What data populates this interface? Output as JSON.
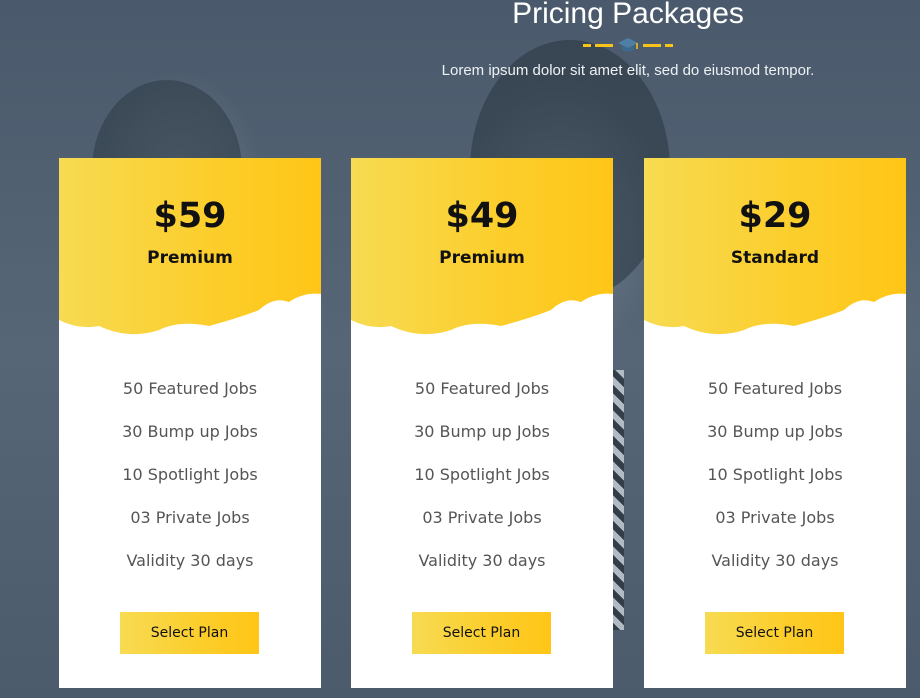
{
  "header": {
    "title": "Pricing Packages",
    "subtitle": "Lorem ipsum dolor sit amet elit, sed do eiusmod tempor.",
    "divider_icon": "graduation-cap-icon"
  },
  "colors": {
    "accent": "#fccd2a",
    "accent_light": "#f7db52",
    "accent_dark": "#ffc617"
  },
  "plans": [
    {
      "price": "$59",
      "name": "Premium",
      "features": [
        "50 Featured Jobs",
        "30 Bump up Jobs",
        "10 Spotlight Jobs",
        "03 Private Jobs",
        "Validity 30 days"
      ],
      "button_label": "Select Plan"
    },
    {
      "price": "$49",
      "name": "Premium",
      "features": [
        "50 Featured Jobs",
        "30 Bump up Jobs",
        "10 Spotlight Jobs",
        "03 Private Jobs",
        "Validity 30 days"
      ],
      "button_label": "Select Plan"
    },
    {
      "price": "$29",
      "name": "Standard",
      "features": [
        "50 Featured Jobs",
        "30 Bump up Jobs",
        "10 Spotlight Jobs",
        "03 Private Jobs",
        "Validity 30 days"
      ],
      "button_label": "Select Plan"
    }
  ]
}
